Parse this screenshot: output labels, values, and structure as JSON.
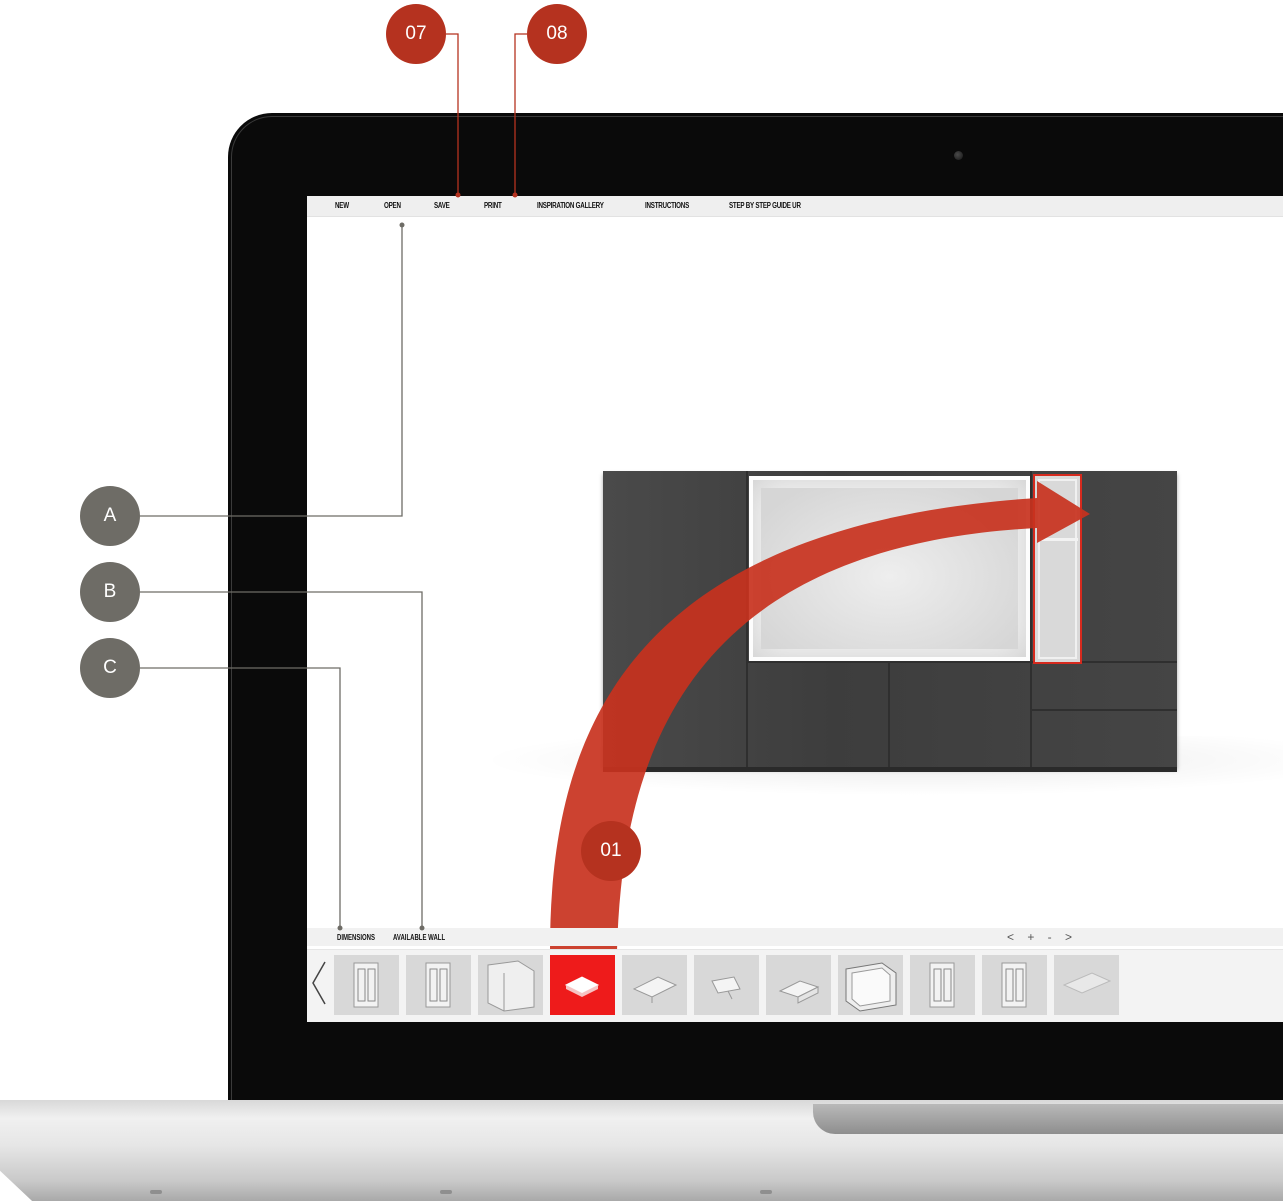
{
  "menu": {
    "items": [
      "NEW",
      "OPEN",
      "SAVE",
      "PRINT",
      "INSPIRATION GALLERY",
      "INSTRUCTIONS",
      "STEP BY STEP GUIDE UR"
    ]
  },
  "toolbar": {
    "labels": [
      "DIMENSIONS",
      "AVAILABLE WALL"
    ],
    "nav_controls": "< + - >"
  },
  "thumbnails": [
    {
      "icon": "tall-cabinet-icon",
      "active": false
    },
    {
      "icon": "tall-cabinet-icon",
      "active": false
    },
    {
      "icon": "corner-cabinet-icon",
      "active": false
    },
    {
      "icon": "shelf-icon",
      "active": true
    },
    {
      "icon": "flat-shelf-icon",
      "active": false
    },
    {
      "icon": "angled-shelf-icon",
      "active": false
    },
    {
      "icon": "small-box-icon",
      "active": false
    },
    {
      "icon": "open-box-icon",
      "active": false
    },
    {
      "icon": "tall-cabinet-icon",
      "active": false
    },
    {
      "icon": "tall-cabinet-icon",
      "active": false
    },
    {
      "icon": "panel-icon",
      "active": false
    }
  ],
  "callouts": {
    "c07": "07",
    "c08": "08",
    "c01": "01",
    "a": "A",
    "b": "B",
    "c": "C"
  },
  "colors": {
    "callout_red": "#b5321f",
    "callout_grey": "#6e6c66",
    "active_thumb": "#ee1b1b",
    "arrow": "#c8321e"
  }
}
